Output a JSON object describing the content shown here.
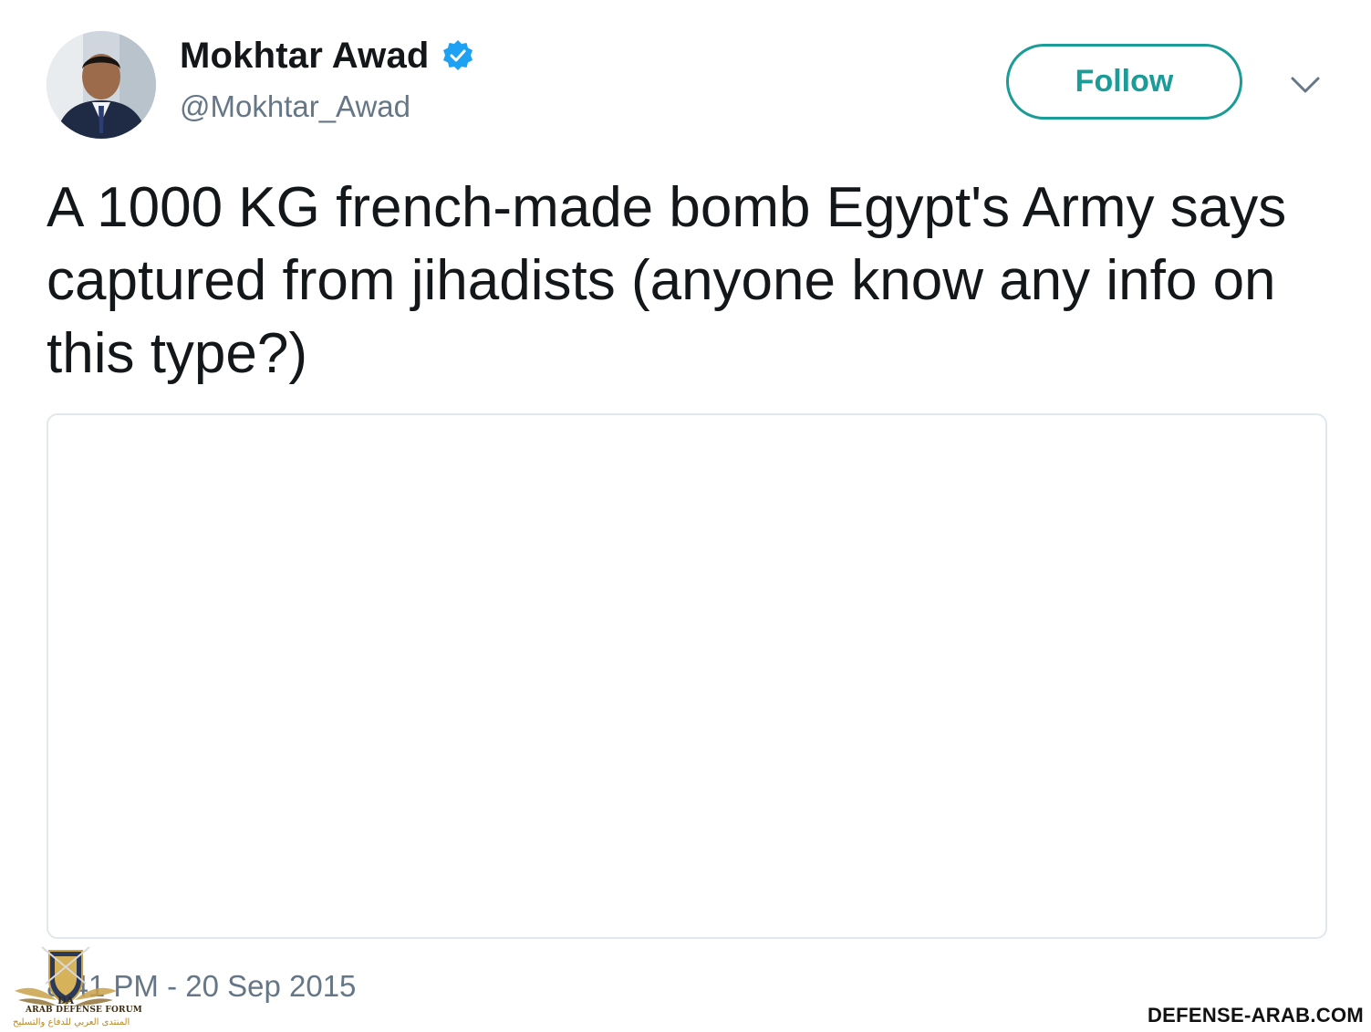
{
  "tweet": {
    "author": {
      "display_name": "Mokhtar Awad",
      "handle": "@Mokhtar_Awad",
      "verified": true,
      "avatar_icon": "profile-photo"
    },
    "follow_label": "Follow",
    "menu_icon": "chevron-down-icon",
    "text": "A 1000 KG french-made bomb Egypt's Army says captured from jihadists (anyone know any info on this type?)",
    "timestamp": "8:41 PM - 20 Sep 2015"
  },
  "watermark": {
    "logo_icon": "arab-defense-forum-emblem",
    "english_name": "ARAB DEFENSE FORUM",
    "arabic_name": "المنتدى العربي للدفاع والتسليح",
    "site": "DEFENSE-ARAB.COM"
  },
  "colors": {
    "accent": "#1b9c98",
    "verified": "#1da1f2",
    "text_primary": "#14171a",
    "text_secondary": "#657786",
    "border": "#e1e8ed"
  }
}
